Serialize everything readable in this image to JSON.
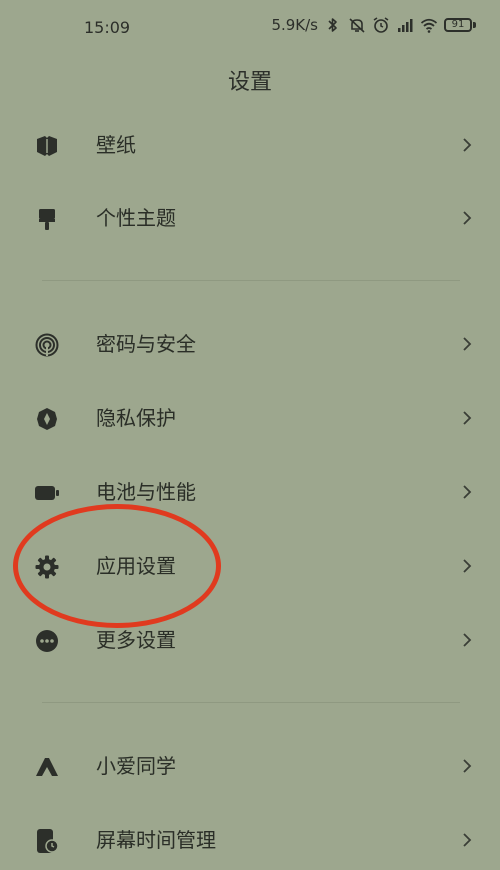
{
  "status_bar": {
    "time": "15:09",
    "net_speed": "5.9K/s",
    "battery_level": "91",
    "icons": [
      "bluetooth-icon",
      "mute-icon",
      "alarm-icon",
      "signal-icon",
      "wifi-icon",
      "battery-icon"
    ]
  },
  "header": {
    "title": "设置"
  },
  "settings": {
    "items": [
      {
        "label": "壁纸",
        "icon": "wallpaper-icon"
      },
      {
        "label": "个性主题",
        "icon": "theme-brush-icon"
      },
      {
        "label": "密码与安全",
        "icon": "fingerprint-icon"
      },
      {
        "label": "隐私保护",
        "icon": "privacy-shield-icon"
      },
      {
        "label": "电池与性能",
        "icon": "battery-performance-icon"
      },
      {
        "label": "应用设置",
        "icon": "gear-icon"
      },
      {
        "label": "更多设置",
        "icon": "more-dots-icon"
      },
      {
        "label": "小爱同学",
        "icon": "xiaoai-icon"
      },
      {
        "label": "屏幕时间管理",
        "icon": "screen-time-icon"
      }
    ]
  },
  "colors": {
    "background": "#9DA78E",
    "text": "#2A2E27",
    "highlight": "#E03A1F"
  }
}
